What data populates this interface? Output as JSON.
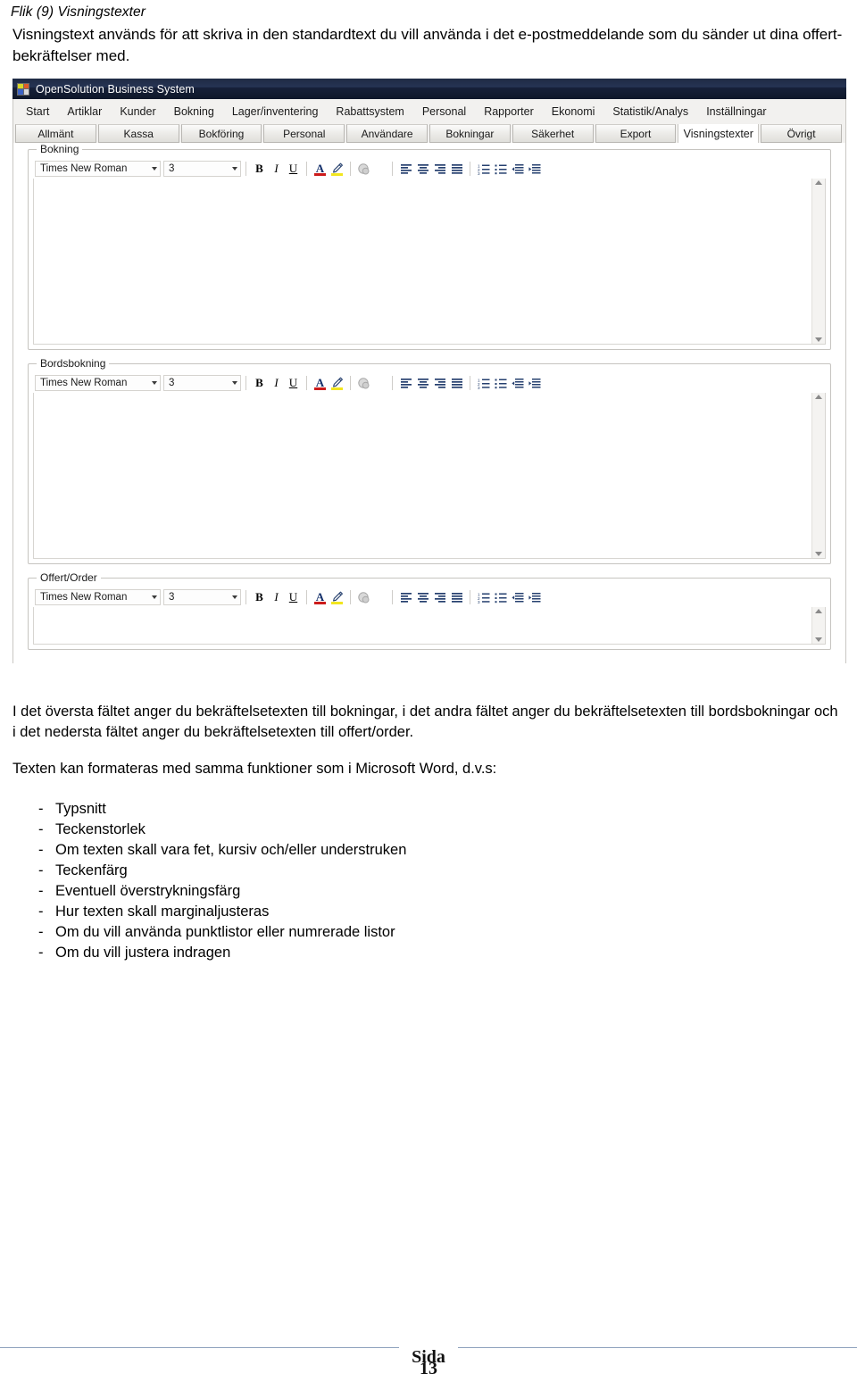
{
  "document": {
    "heading": "Flik (9) Visningstexter",
    "intro": "Visningstext används för att skriva in den standardtext du vill använda i det e-postmeddelande som du sänder ut dina offert-bekräftelser med.",
    "paragraph_1": "I det översta fältet anger du bekräftelsetexten till bokningar, i det andra fältet anger du bekräftelsetexten till bordsbokningar och i det nedersta fältet anger du bekräftelsetexten till offert/order.",
    "paragraph_2": "Texten kan formateras med samma funktioner som i Microsoft Word, d.v.s:",
    "bullets": [
      "Typsnitt",
      "Teckenstorlek",
      "Om texten skall vara fet, kursiv och/eller understruken",
      "Teckenfärg",
      "Eventuell överstrykningsfärg",
      "Hur texten skall marginaljusteras",
      "Om du vill använda punktlistor eller numrerade listor",
      "Om du vill justera indragen"
    ],
    "bullet_marker": "-"
  },
  "app": {
    "titlebar": {
      "title": "OpenSolution Business System",
      "icon": "application-icon"
    },
    "menubar": [
      "Start",
      "Artiklar",
      "Kunder",
      "Bokning",
      "Lager/inventering",
      "Rabattsystem",
      "Personal",
      "Rapporter",
      "Ekonomi",
      "Statistik/Analys",
      "Inställningar"
    ],
    "tabs": [
      {
        "label": "Allmänt",
        "active": false
      },
      {
        "label": "Kassa",
        "active": false
      },
      {
        "label": "Bokföring",
        "active": false
      },
      {
        "label": "Personal",
        "active": false
      },
      {
        "label": "Användare",
        "active": false
      },
      {
        "label": "Bokningar",
        "active": false
      },
      {
        "label": "Säkerhet",
        "active": false
      },
      {
        "label": "Export",
        "active": false
      },
      {
        "label": "Visningstexter",
        "active": true
      },
      {
        "label": "Övrigt",
        "active": false
      }
    ],
    "editors": [
      {
        "legend": "Bokning",
        "font_value": "Times New Roman",
        "size_value": "3",
        "content": ""
      },
      {
        "legend": "Bordsbokning",
        "font_value": "Times New Roman",
        "size_value": "3",
        "content": ""
      },
      {
        "legend": "Offert/Order",
        "font_value": "Times New Roman",
        "size_value": "3",
        "content": ""
      }
    ],
    "toolbar_buttons": [
      {
        "name": "bold-button",
        "glyph": "B"
      },
      {
        "name": "italic-button",
        "glyph": "I"
      },
      {
        "name": "underline-button",
        "glyph": "U"
      },
      {
        "name": "font-color-button",
        "glyph": "A"
      },
      {
        "name": "highlight-color-button",
        "glyph": "pen"
      },
      {
        "name": "insert-image-button",
        "glyph": "image"
      },
      {
        "name": "align-left-button",
        "glyph": "align-left"
      },
      {
        "name": "align-center-button",
        "glyph": "align-center"
      },
      {
        "name": "align-right-button",
        "glyph": "align-right"
      },
      {
        "name": "align-justify-button",
        "glyph": "align-justify"
      },
      {
        "name": "numbered-list-button",
        "glyph": "ordered-list"
      },
      {
        "name": "bullet-list-button",
        "glyph": "unordered-list"
      },
      {
        "name": "decrease-indent-button",
        "glyph": "outdent"
      },
      {
        "name": "increase-indent-button",
        "glyph": "indent"
      }
    ],
    "colors": {
      "titlebar": "#1b2842",
      "font_color_swatch": "#cc1b1b",
      "highlight_swatch": "#f2e61f",
      "chrome": "#f2f1ef"
    }
  },
  "footer": {
    "label": "Sida",
    "page_number": "13",
    "rule_color": "#8ea2bd"
  }
}
